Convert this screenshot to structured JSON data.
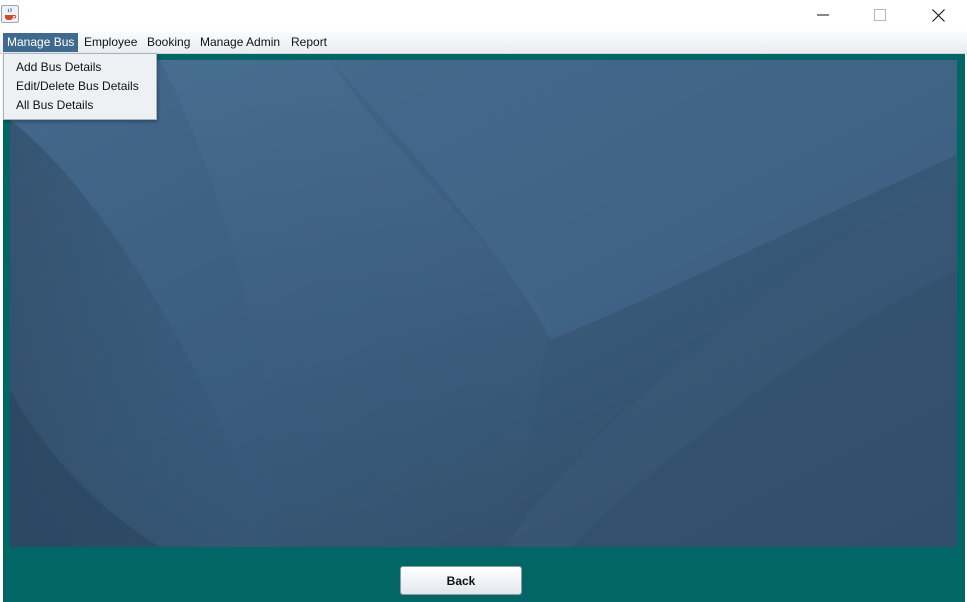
{
  "menubar": {
    "items": [
      {
        "label": "Manage Bus"
      },
      {
        "label": "Employee"
      },
      {
        "label": "Booking"
      },
      {
        "label": "Manage Admin"
      },
      {
        "label": "Report"
      }
    ],
    "active": "Manage Bus"
  },
  "dropdown": {
    "items": [
      {
        "label": "Add Bus Details"
      },
      {
        "label": "Edit/Delete Bus Details"
      },
      {
        "label": "All Bus Details"
      }
    ]
  },
  "footer": {
    "back_label": "Back"
  },
  "colors": {
    "frame_background": "#036666",
    "active_menu": "#3f6a8e",
    "wallpaper_base": "#3a5a78"
  },
  "icons": {
    "app": "java-cup-icon",
    "minimize": "minimize-icon",
    "maximize": "maximize-icon",
    "close": "close-icon"
  }
}
